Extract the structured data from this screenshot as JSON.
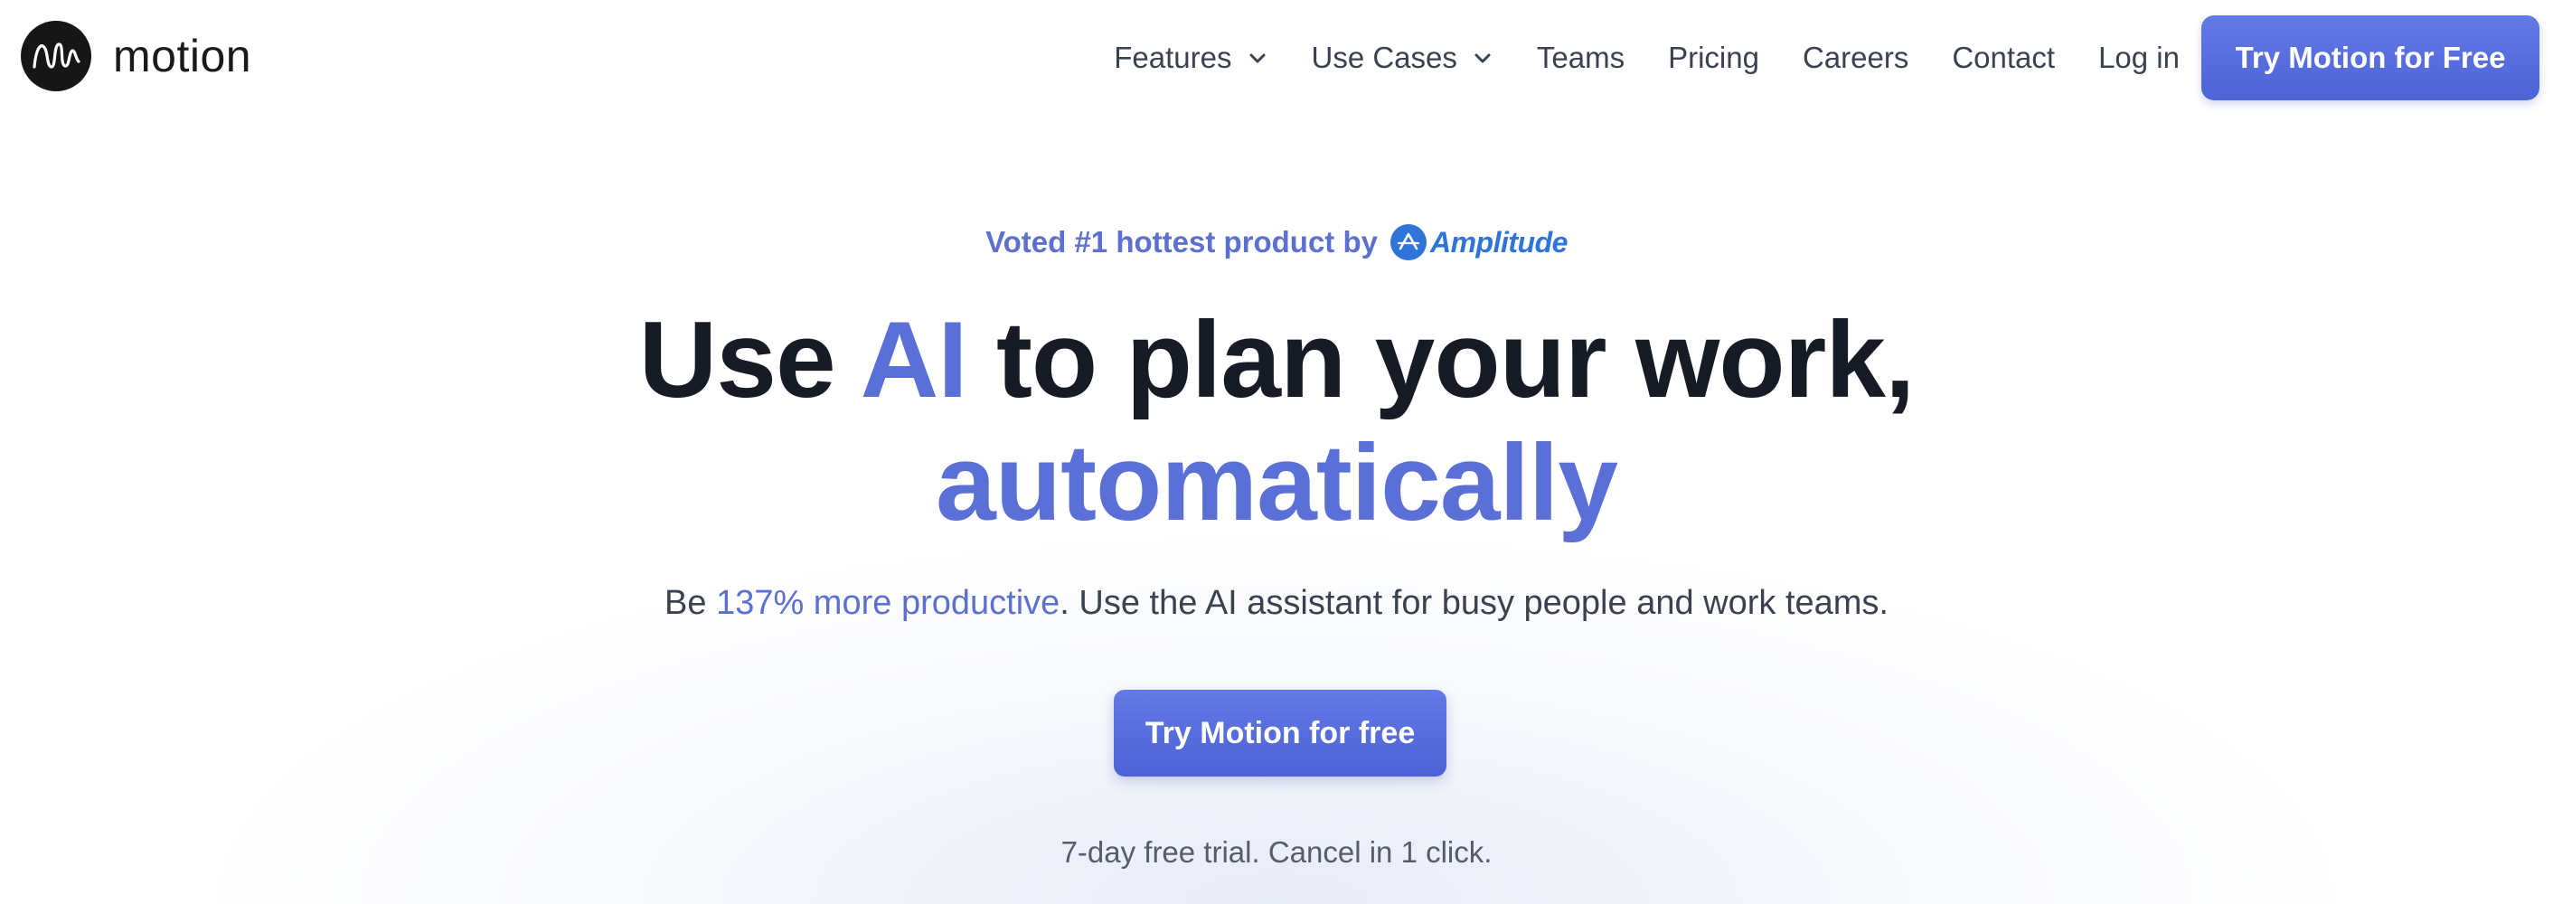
{
  "brand": {
    "name": "motion"
  },
  "nav": {
    "items": [
      {
        "label": "Features",
        "has_dropdown": true
      },
      {
        "label": "Use Cases",
        "has_dropdown": true
      },
      {
        "label": "Teams",
        "has_dropdown": false
      },
      {
        "label": "Pricing",
        "has_dropdown": false
      },
      {
        "label": "Careers",
        "has_dropdown": false
      },
      {
        "label": "Contact",
        "has_dropdown": false
      },
      {
        "label": "Log in",
        "has_dropdown": false
      }
    ],
    "cta_label": "Try Motion for Free"
  },
  "hero": {
    "voted_prefix": "Voted #1 hottest product by",
    "voted_brand": "Amplitude",
    "headline_part1": "Use ",
    "headline_accent": "AI",
    "headline_part2": " to plan your work,",
    "headline_line2": "automatically",
    "subtitle_prefix": "Be ",
    "subtitle_highlight": "137% more productive",
    "subtitle_suffix": ". Use the AI assistant for busy people and work teams.",
    "cta_label": "Try Motion for free",
    "trial_note": "7-day free trial. Cancel in 1 click."
  },
  "colors": {
    "accent": "#5b70d6",
    "button": "#566bdc",
    "amplitude": "#2f74d9",
    "heading": "#161b26"
  },
  "icons": {
    "logo": "motion-logo-icon",
    "dropdown": "chevron-down-icon",
    "amplitude": "amplitude-logo-icon"
  }
}
